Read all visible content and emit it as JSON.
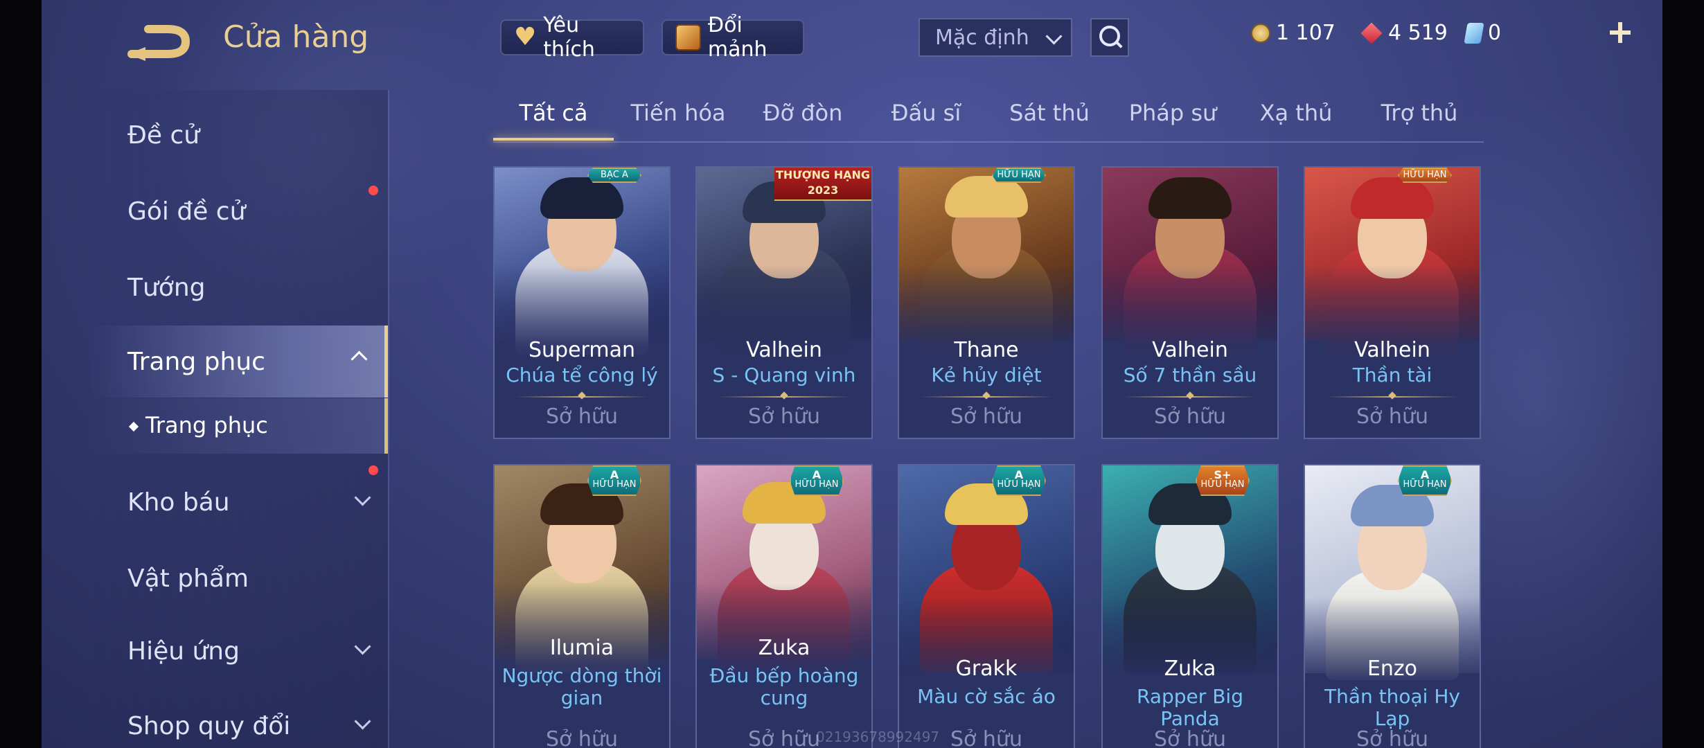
{
  "header": {
    "title": "Cửa hàng",
    "favorites_label": "Yêu thích",
    "exchange_label": "Đổi mảnh",
    "sort_selected": "Mặc định",
    "currencies": [
      {
        "icon": "gold-coin-icon",
        "value": "1 107"
      },
      {
        "icon": "ruby-icon",
        "value": "4 519"
      },
      {
        "icon": "voucher-icon",
        "value": "0"
      }
    ]
  },
  "sidebar": {
    "items": [
      {
        "label": "Đề cử"
      },
      {
        "label": "Gói đề cử"
      },
      {
        "label": "Tướng"
      },
      {
        "label": "Trang phục"
      },
      {
        "label": "Kho báu"
      },
      {
        "label": "Vật phẩm"
      },
      {
        "label": "Hiệu ứng"
      },
      {
        "label": "Shop quy đổi"
      }
    ],
    "sub_item": "Trang phục"
  },
  "tabs": [
    "Tất cả",
    "Tiến hóa",
    "Đỡ đòn",
    "Đấu sĩ",
    "Sát thủ",
    "Pháp sư",
    "Xạ thủ",
    "Trợ thủ"
  ],
  "cards": [
    {
      "hero": "Superman",
      "skin": "Chúa tể công lý",
      "status": "Sở hữu",
      "badge_top": "",
      "badge_sub": "BẠC A"
    },
    {
      "hero": "Valhein",
      "skin": "S - Quang vinh",
      "status": "Sở hữu",
      "ribbon_top": "THƯỢNG HẠNG",
      "ribbon_sub": "2023"
    },
    {
      "hero": "Thane",
      "skin": "Kẻ hủy diệt",
      "status": "Sở hữu",
      "badge_top": "",
      "badge_sub": "HỮU HẠN"
    },
    {
      "hero": "Valhein",
      "skin": "Số 7 thần sầu",
      "status": "Sở hữu",
      "badge_top": "",
      "badge_sub": ""
    },
    {
      "hero": "Valhein",
      "skin": "Thần tài",
      "status": "Sở hữu",
      "badge_top": "",
      "badge_sub": "HỮU HẠN"
    },
    {
      "hero": "Ilumia",
      "skin": "Ngược dòng thời gian",
      "status": "Sở hữu",
      "badge_top": "A",
      "badge_sub": "HỮU HẠN"
    },
    {
      "hero": "Zuka",
      "skin": "Đầu bếp hoàng cung",
      "status": "Sở hữu",
      "badge_top": "A",
      "badge_sub": "HỮU HẠN"
    },
    {
      "hero": "Grakk",
      "skin": "Màu cờ sắc áo",
      "status": "Sở hữu",
      "badge_top": "A",
      "badge_sub": "HỮU HẠN"
    },
    {
      "hero": "Zuka",
      "skin": "Rapper Big Panda",
      "status": "Sở hữu",
      "badge_top": "S+",
      "badge_sub": "HỮU HẠN"
    },
    {
      "hero": "Enzo",
      "skin": "Thần thoại Hy Lạp",
      "status": "Sở hữu",
      "badge_top": "A",
      "badge_sub": "HỮU HẠN"
    }
  ],
  "watermark": "02193678992497",
  "colors": {
    "accent_gold": "#e8cf8e",
    "skin_name_blue": "#79c4f4",
    "notification_red": "#ff4b4b"
  }
}
